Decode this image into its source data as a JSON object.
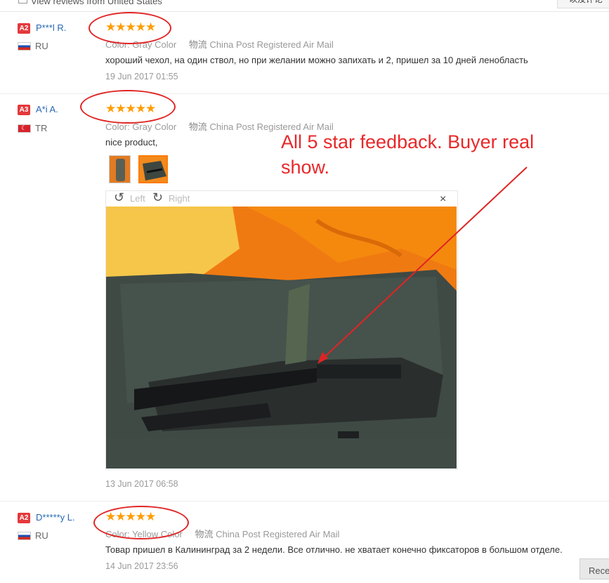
{
  "top": {
    "filter_label": "View reviews from United States",
    "button_label": "以及评论"
  },
  "reviews": [
    {
      "badge": "A2",
      "name": "P***l R.",
      "country": "RU",
      "stars": "★★★★★",
      "color_key": "Color:",
      "color_value": "Gray Color",
      "ship_key": "物流",
      "ship_value": "China Post Registered Air Mail",
      "text": "хороший чехол, на один ствол, но при желании можно запихать и 2, пришел за 10 дней ленобласть",
      "date": "19 Jun 2017 01:55"
    },
    {
      "badge": "A3",
      "name": "A*i A.",
      "country": "TR",
      "stars": "★★★★★",
      "color_key": "Color:",
      "color_value": "Gray Color",
      "ship_key": "物流",
      "ship_value": "China Post Registered Air Mail",
      "text": "nice product,",
      "date": "13 Jun 2017 06:58"
    },
    {
      "badge": "A2",
      "name": "D*****y L.",
      "country": "RU",
      "stars": "★★★★★",
      "color_key": "Color:",
      "color_value": "Yellow Color",
      "ship_key": "物流",
      "ship_value": "China Post Registered Air Mail",
      "text": "Товар пришел в Калининград за 2 недели. Все отлично. не хватает конечно фиксаторов в большом отделе.",
      "date": "14 Jun 2017 23:56"
    }
  ],
  "viewer": {
    "left_label": "Left",
    "right_label": "Right",
    "close": "×"
  },
  "annotation": {
    "line1": "All 5 star feedback. Buyer real",
    "line2": "show."
  },
  "bottom_button": "Rece",
  "colors": {
    "annotation_red": "#e02424",
    "star_orange": "#ff9c00",
    "link_blue": "#2668b3"
  }
}
